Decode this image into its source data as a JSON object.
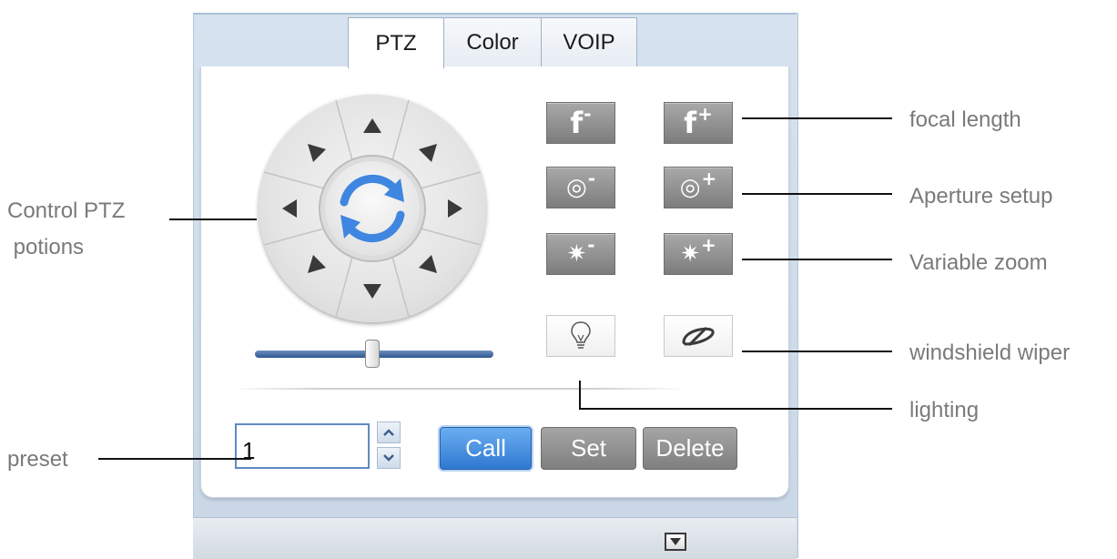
{
  "tabs": [
    {
      "label": "PTZ",
      "active": true
    },
    {
      "label": "Color",
      "active": false
    },
    {
      "label": "VOIP",
      "active": false
    }
  ],
  "ptz": {
    "center_icon": "rotate-refresh-icon",
    "directions": [
      "up",
      "up-right",
      "right",
      "down-right",
      "down",
      "down-left",
      "left",
      "up-left"
    ],
    "speed_slider_value": 0.5
  },
  "buttons": {
    "focal_minus": {
      "glyph": "f",
      "sign": "-",
      "icon": "focal-length-minus-icon"
    },
    "focal_plus": {
      "glyph": "f",
      "sign": "+",
      "icon": "focal-length-plus-icon"
    },
    "aperture_minus": {
      "glyph": "◎",
      "sign": "-",
      "icon": "aperture-minus-icon"
    },
    "aperture_plus": {
      "glyph": "◎",
      "sign": "+",
      "icon": "aperture-plus-icon"
    },
    "zoom_minus": {
      "glyph": "✷",
      "sign": "-",
      "icon": "zoom-minus-icon"
    },
    "zoom_plus": {
      "glyph": "✷",
      "sign": "+",
      "icon": "zoom-plus-icon"
    },
    "lighting": {
      "icon": "lightbulb-icon"
    },
    "wiper": {
      "icon": "windshield-wiper-icon"
    }
  },
  "preset": {
    "value": "1",
    "call_label": "Call",
    "set_label": "Set",
    "delete_label": "Delete"
  },
  "annotations": {
    "control_ptz_line1": "Control PTZ",
    "control_ptz_line2": " potions",
    "preset": "preset",
    "focal_length": "focal length",
    "aperture": "Aperture setup",
    "zoom": "Variable zoom",
    "wiper": "windshield wiper",
    "lighting": "lighting"
  },
  "colors": {
    "accent_blue": "#2f78d1",
    "tab_strip": "#d6e2ef",
    "grey_button": "#8f8f8f",
    "annotation_text": "#7a7a7a"
  }
}
